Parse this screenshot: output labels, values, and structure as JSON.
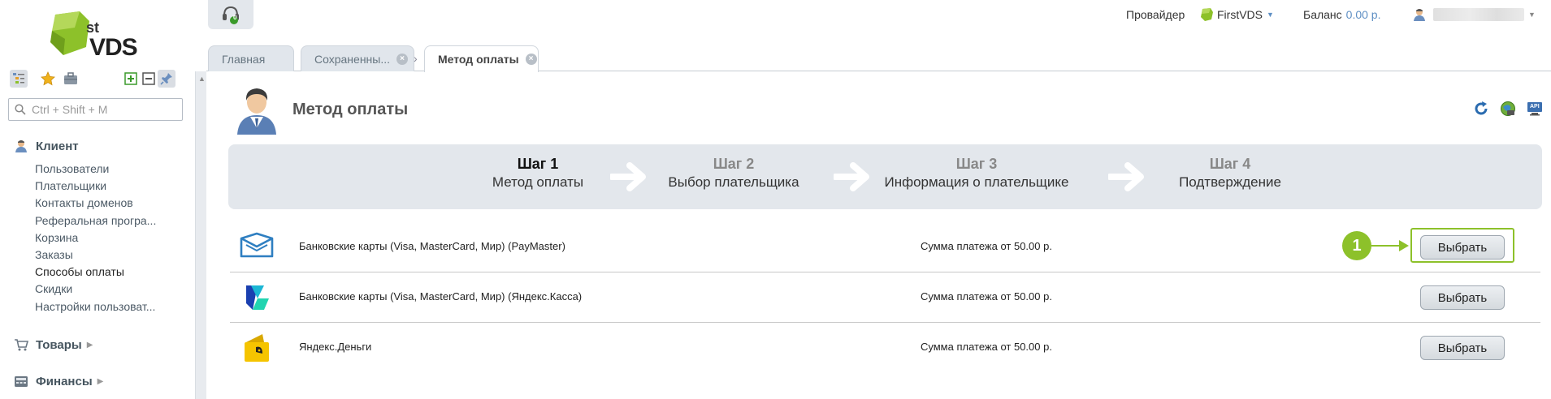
{
  "app": {
    "logo_small": "st",
    "logo_big": "VDS"
  },
  "sidebar": {
    "search_placeholder": "Ctrl + Shift + M",
    "groups": [
      {
        "title": "Клиент"
      },
      {
        "title": "Товары"
      },
      {
        "title": "Финансы"
      }
    ],
    "client_items": [
      {
        "label": "Пользователи"
      },
      {
        "label": "Плательщики"
      },
      {
        "label": "Контакты доменов"
      },
      {
        "label": "Реферальная програ..."
      },
      {
        "label": "Корзина"
      },
      {
        "label": "Заказы"
      },
      {
        "label": "Способы оплаты"
      },
      {
        "label": "Скидки"
      },
      {
        "label": "Настройки пользоват..."
      }
    ]
  },
  "header": {
    "headset_badge": "0",
    "provider_label": "Провайдер",
    "provider_name": "FirstVDS",
    "balance_label": "Баланс",
    "balance_value": "0.00 р."
  },
  "tabs": [
    {
      "label": "Главная"
    },
    {
      "label": "Сохраненны..."
    },
    {
      "label": "Метод оплаты"
    }
  ],
  "page": {
    "title": "Метод оплаты",
    "api_label": "API"
  },
  "wizard": {
    "steps": [
      {
        "num": "Шаг 1",
        "label": "Метод оплаты"
      },
      {
        "num": "Шаг 2",
        "label": "Выбор плательщика"
      },
      {
        "num": "Шаг 3",
        "label": "Информация о плательщике"
      },
      {
        "num": "Шаг 4",
        "label": "Подтверждение"
      }
    ]
  },
  "methods": [
    {
      "name": "Банковские карты (Visa, MasterCard, Мир) (PayMaster)",
      "sum": "Сумма платежа от 50.00 р.",
      "button": "Выбрать"
    },
    {
      "name": "Банковские карты (Visa, MasterCard, Мир) (Яндекс.Касса)",
      "sum": "Сумма платежа от 50.00 р.",
      "button": "Выбрать"
    },
    {
      "name": "Яндекс.Деньги",
      "sum": "Сумма платежа от 50.00 р.",
      "button": "Выбрать"
    }
  ],
  "callout": {
    "number": "1"
  },
  "colors": {
    "accent_green": "#8dc12a",
    "link_blue": "#5e8fc4",
    "panel_gray": "#e3e7ec"
  }
}
